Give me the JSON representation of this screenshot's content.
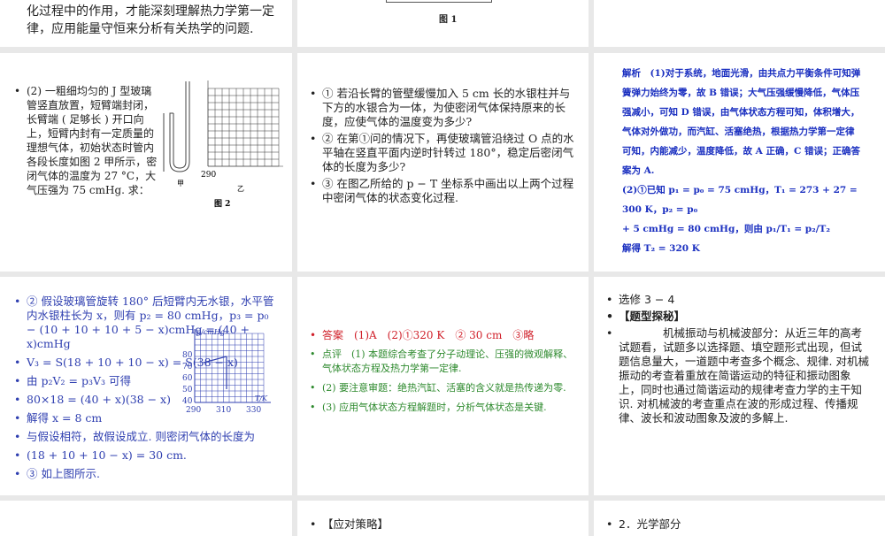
{
  "slides": [
    {
      "text": [
        "化过程中的作用，才能深刻理解热力学第一定",
        "律，应用能量守恒来分析有关热学的问题."
      ]
    },
    {
      "figure_caption": "图 1"
    },
    {},
    {
      "bullet": "(2) 一粗细均匀的 J 型玻璃管竖直放置，短臂端封闭，长臂端 ( 足够长 ) 开口向上，短臂内封有一定质量的理想气体，初始状态时管内各段长度如图 2 甲所示，密闭气体的温度为 27 °C，大气压强为 75 cmHg. 求：",
      "fig_label_a": "甲",
      "fig_label_b": "乙",
      "fig_axis": "290",
      "figure_caption": "图 2"
    },
    {
      "bullets": [
        "① 若沿长臂的管壁缓慢加入 5 cm 长的水银柱并与下方的水银合为一体，为使密闭气体保持原来的长度，应使气体的温度变为多少?",
        "② 在第①问的情况下，再使玻璃管沿绕过 O 点的水平轴在竖直平面内逆时针转过 180°，稳定后密闭气体的长度为多少?",
        "③ 在图乙所给的 p − T 坐标系中画出以上两个过程中密闭气体的状态变化过程."
      ]
    },
    {
      "lines": [
        "解析　(1)对于系统，地面光滑，由共点力平衡条件可知弹",
        "簧弹力始终为零，故 B 错误；大气压强缓慢降低，气体压",
        "强减小，可知 D 错误，由气体状态方程可知，体积增大，",
        "气体对外做功，而汽缸、活塞绝热，根据热力学第一定律",
        "可知，内能减少，温度降低，故 A 正确，C 错误；正确答",
        "案为 A.",
        "(2)①已知 p₁ = p₀ = 75 cmHg，T₁ = 273 + 27 = 300 K，p₂ = p₀",
        "+ 5 cmHg = 80 cmHg，则由 p₁/T₁ = p₂/T₂",
        "解得 T₂ = 320 K"
      ]
    },
    {
      "bullets": [
        "② 假设玻璃管旋转 180° 后短臂内无水银，水平管内水银柱长为 x，则有 p₂ = 80 cmHg，p₃ = p₀ − (10 + 10 + 10 + 5 − x)cmHg = (40 + x)cmHg",
        "V₃ = S(18 + 10 + 10 − x) = S(38 − x)",
        "由 p₂V₂ = p₃V₃ 可得",
        "80×18 = (40 + x)(38 − x)",
        "解得 x = 8 cm",
        "与假设相符，故假设成立. 则密闭气体的长度为",
        "(18 + 10 + 10 − x) = 30 cm.",
        "③ 如上图所示."
      ],
      "graph": {
        "ylabel": "p/cmHg",
        "xlabel": "T/K",
        "yticks": [
          "80",
          "70",
          "60",
          "50",
          "40"
        ],
        "xticks": [
          "290",
          "310",
          "330"
        ]
      }
    },
    {
      "answer": "答案　(1)A　(2)①320 K　② 30 cm　③略",
      "bullets": [
        "点评　(1) 本题综合考查了分子动理论、压强的微观解释、气体状态方程及热力学第一定律.",
        "(2) 要注意审题：绝热汽缸、活塞的含义就是热传递为零.",
        "(3) 应用气体状态方程解题时，分析气体状态是关键."
      ]
    },
    {
      "bullets": [
        "选修 3 − 4",
        "【题型探秘】",
        "　　　　机械振动与机械波部分：从近三年的高考试题看，试题多以选择题、填空题形式出现，但试题信息量大，一道题中考查多个概念、规律. 对机械振动的考查着重放在简谐运动的特征和振动图象上，同时也通过简谐运动的规律考查力学的主干知识. 对机械波的考查重点在波的形成过程、传播规律、波长和波动图象及波的多解上."
      ]
    },
    {},
    {
      "bullets": [
        "【应对策略】"
      ]
    },
    {
      "bullets": [
        "2．光学部分"
      ]
    }
  ]
}
